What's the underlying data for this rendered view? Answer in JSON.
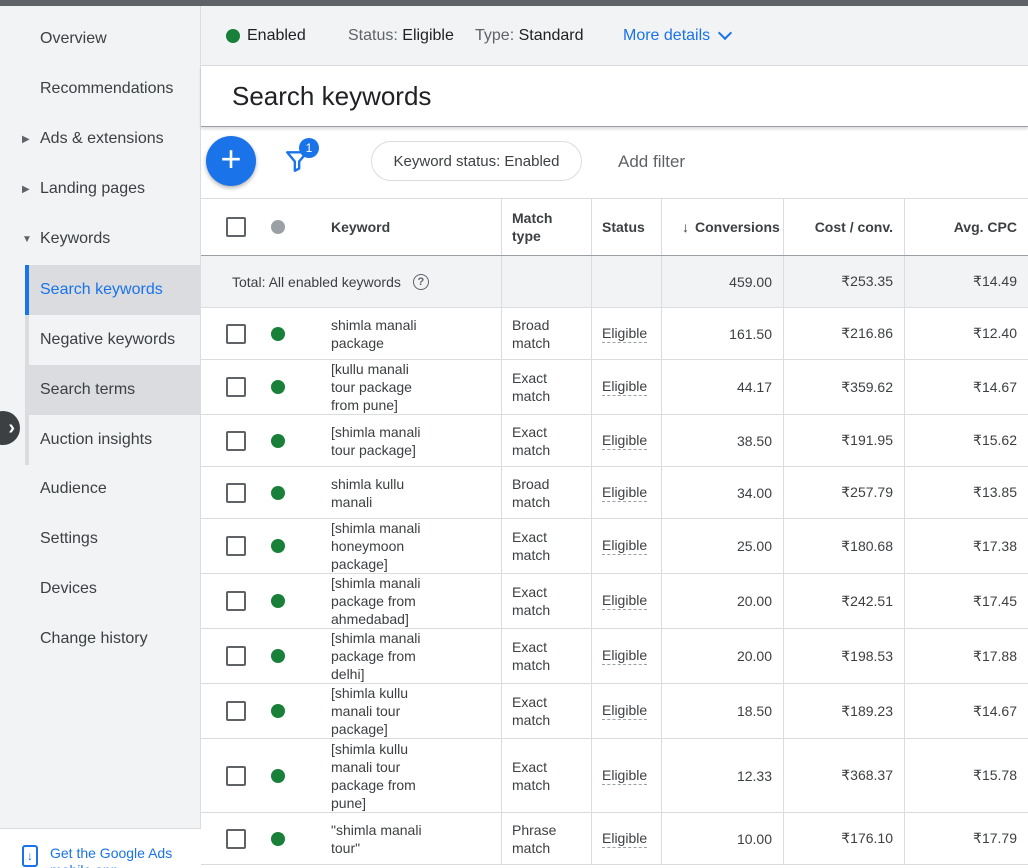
{
  "sidebar": {
    "items": [
      {
        "label": "Overview"
      },
      {
        "label": "Recommendations"
      },
      {
        "label": "Ads & extensions"
      },
      {
        "label": "Landing pages"
      },
      {
        "label": "Keywords"
      },
      {
        "label": "Search keywords"
      },
      {
        "label": "Negative keywords"
      },
      {
        "label": "Search terms"
      },
      {
        "label": "Auction insights"
      },
      {
        "label": "Audience"
      },
      {
        "label": "Settings"
      },
      {
        "label": "Devices"
      },
      {
        "label": "Change history"
      }
    ],
    "mobile_app": "Get the Google Ads mobile app"
  },
  "status_bar": {
    "enabled": "Enabled",
    "status_label": "Status:",
    "status_value": "Eligible",
    "type_label": "Type:",
    "type_value": "Standard",
    "more_details": "More details"
  },
  "page_title": "Search keywords",
  "toolbar": {
    "filter_count": "1",
    "chip": "Keyword status: Enabled",
    "add_filter": "Add filter"
  },
  "table": {
    "headers": {
      "keyword": "Keyword",
      "match_type": "Match type",
      "status": "Status",
      "conversions": "Conversions",
      "cost_conv": "Cost / conv.",
      "avg_cpc": "Avg. CPC"
    },
    "total": {
      "label": "Total: All enabled keywords",
      "conversions": "459.00",
      "cost_conv": "₹253.35",
      "avg_cpc": "₹14.49"
    },
    "rows": [
      {
        "keyword": "shimla manali package",
        "match": "Broad match",
        "status": "Eligible",
        "conversions": "161.50",
        "cost_conv": "₹216.86",
        "avg_cpc": "₹12.40"
      },
      {
        "keyword": "[kullu manali tour package from pune]",
        "match": "Exact match",
        "status": "Eligible",
        "conversions": "44.17",
        "cost_conv": "₹359.62",
        "avg_cpc": "₹14.67"
      },
      {
        "keyword": "[shimla manali tour package]",
        "match": "Exact match",
        "status": "Eligible",
        "conversions": "38.50",
        "cost_conv": "₹191.95",
        "avg_cpc": "₹15.62"
      },
      {
        "keyword": "shimla kullu manali",
        "match": "Broad match",
        "status": "Eligible",
        "conversions": "34.00",
        "cost_conv": "₹257.79",
        "avg_cpc": "₹13.85"
      },
      {
        "keyword": "[shimla manali honeymoon package]",
        "match": "Exact match",
        "status": "Eligible",
        "conversions": "25.00",
        "cost_conv": "₹180.68",
        "avg_cpc": "₹17.38"
      },
      {
        "keyword": "[shimla manali package from ahmedabad]",
        "match": "Exact match",
        "status": "Eligible",
        "conversions": "20.00",
        "cost_conv": "₹242.51",
        "avg_cpc": "₹17.45"
      },
      {
        "keyword": "[shimla manali package from delhi]",
        "match": "Exact match",
        "status": "Eligible",
        "conversions": "20.00",
        "cost_conv": "₹198.53",
        "avg_cpc": "₹17.88"
      },
      {
        "keyword": "[shimla kullu manali tour package]",
        "match": "Exact match",
        "status": "Eligible",
        "conversions": "18.50",
        "cost_conv": "₹189.23",
        "avg_cpc": "₹14.67"
      },
      {
        "keyword": "[shimla kullu manali tour package from pune]",
        "match": "Exact match",
        "status": "Eligible",
        "conversions": "12.33",
        "cost_conv": "₹368.37",
        "avg_cpc": "₹15.78"
      },
      {
        "keyword": "\"shimla manali tour\"",
        "match": "Phrase match",
        "status": "Eligible",
        "conversions": "10.00",
        "cost_conv": "₹176.10",
        "avg_cpc": "₹17.79"
      }
    ]
  }
}
